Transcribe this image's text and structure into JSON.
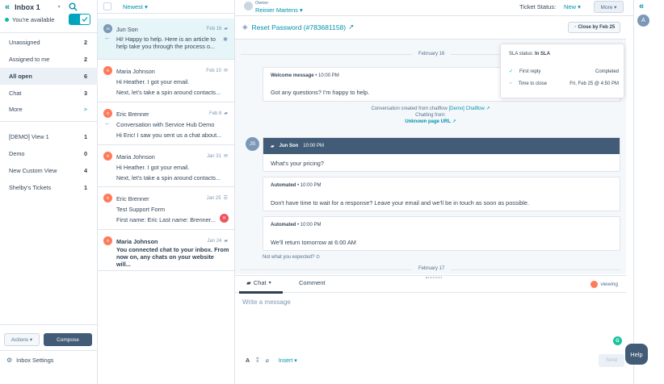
{
  "sidebar": {
    "title": "Inbox 1",
    "availability": "You're available",
    "nav": [
      {
        "label": "Unassigned",
        "count": "2"
      },
      {
        "label": "Assigned to me",
        "count": "2"
      },
      {
        "label": "All open",
        "count": "6"
      },
      {
        "label": "Chat",
        "count": "3"
      },
      {
        "label": "More",
        "count": ">"
      }
    ],
    "views": [
      {
        "label": "[DEMO] View 1",
        "count": "1"
      },
      {
        "label": "Demo",
        "count": "0"
      },
      {
        "label": "New Custom View",
        "count": "4"
      },
      {
        "label": "Shelby's Tickets",
        "count": "1"
      }
    ],
    "actions_label": "Actions ▾",
    "compose_label": "Compose",
    "settings_label": "Inbox Settings"
  },
  "list": {
    "sort_label": "Newest ▾",
    "conversations": [
      {
        "avatar": "JS",
        "name": "Jun Son",
        "date": "Feb 16",
        "lines": [
          "Hi! Happy to help. Here is an article to help take you through the process o..."
        ]
      },
      {
        "avatar": "HS",
        "name": "Maria Johnson",
        "date": "Feb 10",
        "lines": [
          "Hi Heather. I got your email.",
          "Next, let's take a spin around contacts..."
        ]
      },
      {
        "avatar": "HS",
        "name": "Eric Brenner",
        "date": "Feb 8",
        "lines": [
          "Conversation with Service Hub Demo",
          "Hi Eric! I saw you sent us a chat about..."
        ]
      },
      {
        "avatar": "HS",
        "name": "Maria Johnson",
        "date": "Jan 31",
        "lines": [
          "Hi Heather. I got your email.",
          "Next, let's take a spin around contacts..."
        ]
      },
      {
        "avatar": "HS",
        "name": "Eric Brenner",
        "date": "Jan 25",
        "lines": [
          "Test Support Form",
          "First name: Eric Last name: Brenner..."
        ]
      },
      {
        "avatar": "HS",
        "name": "Maria Johnson",
        "date": "Jan 24",
        "lines": [
          "You connected chat to your inbox. From now on, any chats on your website will..."
        ]
      }
    ]
  },
  "header": {
    "owner_label": "Owner",
    "owner_name": "Reinier Martens ▾",
    "ticket_status_label": "Ticket Status:",
    "ticket_status_value": "New ▾",
    "more_label": "More ▾",
    "subject": "Reset Password (#783681158)",
    "close_by": "Close by Feb 25"
  },
  "sla": {
    "status_label": "SLA status:",
    "status_value": "In SLA",
    "first_reply_label": "First reply",
    "first_reply_value": "Completed",
    "time_to_close_label": "Time to close",
    "time_to_close_value": "Fri, Feb 25 @ 4:50 PM"
  },
  "thread": {
    "date1": "February 16",
    "welcome_header": "Welcome message",
    "welcome_time": "• 10:00 PM",
    "welcome_text": "Got any questions? I'm happy to help.",
    "created_from": "Conversation created from chatflow",
    "chatflow_link": "[Demo] Chatflow",
    "chatting_from": "Chatting from:",
    "page_url": "Unknown page URL",
    "js_avatar": "JS",
    "js_name": "Jun Son",
    "js_time": "10:00 PM",
    "js_text": "What's your pricing?",
    "auto1_header": "Automated",
    "auto1_time": "• 10:00 PM",
    "auto1_text": "Don't have time to wait for a response? Leave your email and we'll be in touch as soon as possible.",
    "auto2_header": "Automated",
    "auto2_time": "• 10:00 PM",
    "auto2_text": "We'll return tomorrow at 6:00 AM",
    "not_expected": "Not what you expected?",
    "date2": "February 17"
  },
  "composer": {
    "tab_chat": "Chat",
    "tab_comment": "Comment",
    "viewing": "viewing",
    "placeholder": "Write a message",
    "insert_label": "Insert ▾",
    "send_label": "Send"
  },
  "rail": {
    "avatar": "A",
    "help": "Help"
  },
  "colors": {
    "accent": "#0091ae",
    "toggle": "#00a4bd",
    "dark": "#425b76",
    "hubspot": "#ff7a59"
  }
}
